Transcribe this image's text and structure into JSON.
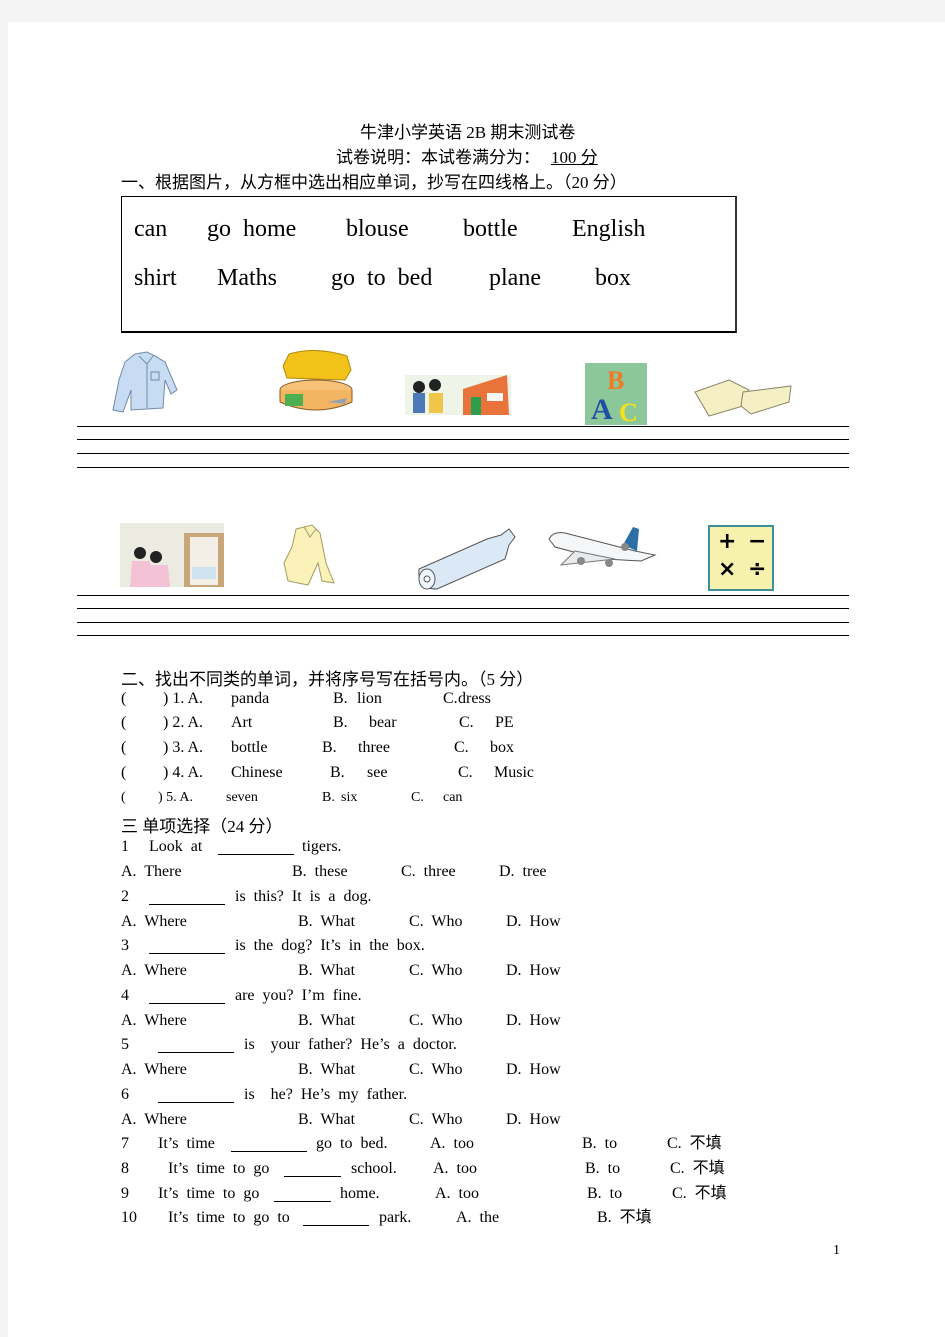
{
  "header": {
    "title": "牛津小学英语 2B 期末测试卷",
    "subtitle_prefix": "试卷说明：本试卷满分为：",
    "subtitle_score": "100 分"
  },
  "section1": {
    "heading": "一、根据图片，从方框中选出相应单词，抄写在四线格上。（20 分）",
    "word_bank_row1": [
      "can",
      "go  home",
      "blouse",
      "bottle",
      "English"
    ],
    "word_bank_row2": [
      "shirt",
      "Maths",
      "go  to  bed",
      "plane",
      "box"
    ],
    "pictures_row1": [
      "shirt-picture",
      "can-picture",
      "go-home-picture",
      "english-abc-picture",
      "box-picture"
    ],
    "pictures_row2": [
      "go-to-bed-picture",
      "blouse-picture",
      "bottle-picture",
      "plane-picture",
      "maths-picture"
    ],
    "maths_symbols": [
      "+",
      "−",
      "×",
      "÷"
    ]
  },
  "section2": {
    "heading": "二、找出不同类的单词，并将序号写在括号内。（5 分）",
    "items": [
      {
        "num": ") 1. A.",
        "a": "panda",
        "b_label": "B.",
        "b": "lion",
        "c_label": "C.",
        "c": "dress"
      },
      {
        "num": ") 2. A.",
        "a": "Art",
        "b_label": "B.",
        "b": "bear",
        "c_label": "C.",
        "c": "PE"
      },
      {
        "num": ") 3. A.",
        "a": "bottle",
        "b_label": "B.",
        "b": "three",
        "c_label": "C.",
        "c": "box"
      },
      {
        "num": ") 4. A.",
        "a": "Chinese",
        "b_label": "B.",
        "b": "see",
        "c_label": "C.",
        "c": "Music"
      },
      {
        "num": ") 5. A.",
        "a": "seven",
        "b_label": "B.",
        "b": "six",
        "c_label": "C.",
        "c": "can"
      }
    ],
    "open_paren": "("
  },
  "section3": {
    "heading": "三  单项选择（24 分）",
    "questions": [
      {
        "num": "1",
        "before": "Look  at",
        "after": "tigers.",
        "options": [
          "A.  There",
          "B.  these",
          "C.  three",
          "D.  tree"
        ]
      },
      {
        "num": "2",
        "before": "",
        "after": "is  this?  It  is  a  dog.",
        "options": [
          "A.  Where",
          "B.  What",
          "C.  Who",
          "D.  How"
        ]
      },
      {
        "num": "3",
        "before": "",
        "after": "is  the  dog?  It’s  in  the  box.",
        "options": [
          "A.  Where",
          "B.  What",
          "C.  Who",
          "D.  How"
        ]
      },
      {
        "num": "4",
        "before": "",
        "after": "are  you?  I’m  fine.",
        "options": [
          "A.  Where",
          "B.  What",
          "C.  Who",
          "D.  How"
        ]
      },
      {
        "num": "5",
        "before": "",
        "after": "is    your  father?  He’s  a  doctor.",
        "options": [
          "A.  Where",
          "B.  What",
          "C.  Who",
          "D.  How"
        ]
      },
      {
        "num": "6",
        "before": "",
        "after": "is    he?  He’s  my  father.",
        "options": [
          "A.  Where",
          "B.  What",
          "C.  Who",
          "D.  How"
        ]
      },
      {
        "num": "7",
        "before": "It’s  time",
        "after": "go  to  bed.",
        "options": [
          "A.  too",
          "B.  to",
          "C.  不填"
        ]
      },
      {
        "num": "8",
        "before": "It’s  time  to  go",
        "after": "school.",
        "options": [
          "A.  too",
          "B.  to",
          "C.  不填"
        ]
      },
      {
        "num": "9",
        "before": "It’s  time  to  go",
        "after": "home.",
        "options": [
          "A.  too",
          "B.  to",
          "C.  不填"
        ]
      },
      {
        "num": "10",
        "before": "It’s  time  to  go  to",
        "after": "park.",
        "options": [
          "A.  the",
          "B.  不填"
        ]
      }
    ]
  },
  "footer": {
    "page_number": "1"
  }
}
